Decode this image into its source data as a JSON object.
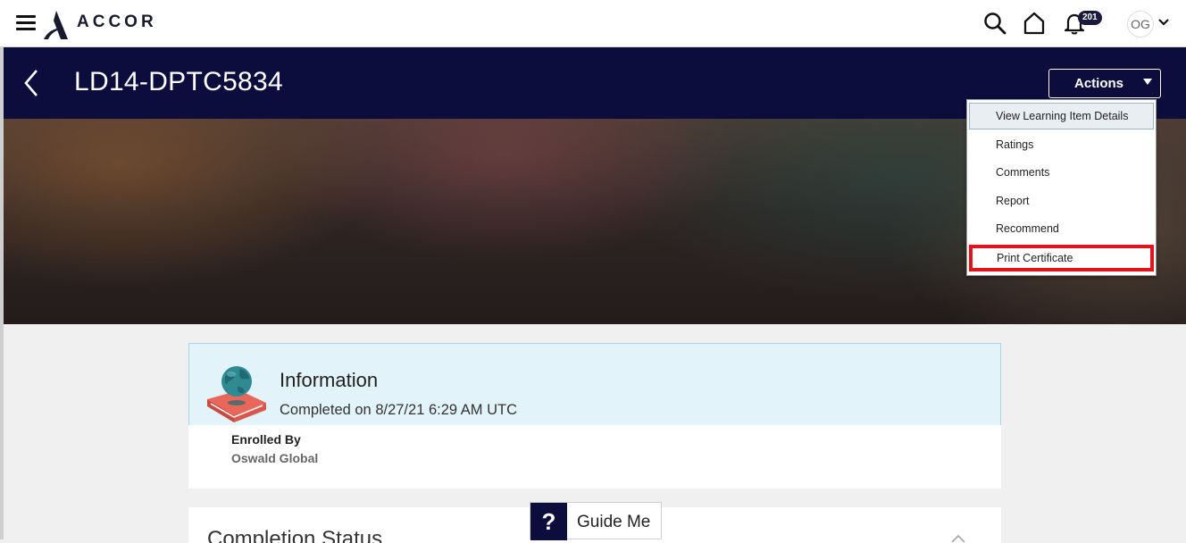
{
  "header": {
    "brand": "ACCOR",
    "notification_count": "201",
    "user_initials": "OG",
    "icons": [
      "menu-icon",
      "accor-logo-icon",
      "search-icon",
      "home-icon",
      "bell-icon",
      "chevron-down-icon"
    ]
  },
  "title_bar": {
    "title": "LD14-DPTC5834",
    "actions_label": "Actions"
  },
  "actions_menu": {
    "items": [
      {
        "label": "View Learning Item Details",
        "state": "hover"
      },
      {
        "label": "Ratings"
      },
      {
        "label": "Comments"
      },
      {
        "label": "Report"
      },
      {
        "label": "Recommend"
      },
      {
        "label": "Print Certificate",
        "state": "highlighted"
      }
    ],
    "highlight_color": "#e0141e"
  },
  "information": {
    "title": "Information",
    "completed": "Completed on 8/27/21 6:29 AM UTC",
    "enrolled_by_label": "Enrolled By",
    "enrolled_by_value": "Oswald Global"
  },
  "completion_status": {
    "title": "Completion Status"
  },
  "guide": {
    "icon": "?",
    "label": "Guide Me"
  },
  "colors": {
    "header_navy": "#0c0c3d",
    "info_bg": "#e3f3fa"
  }
}
